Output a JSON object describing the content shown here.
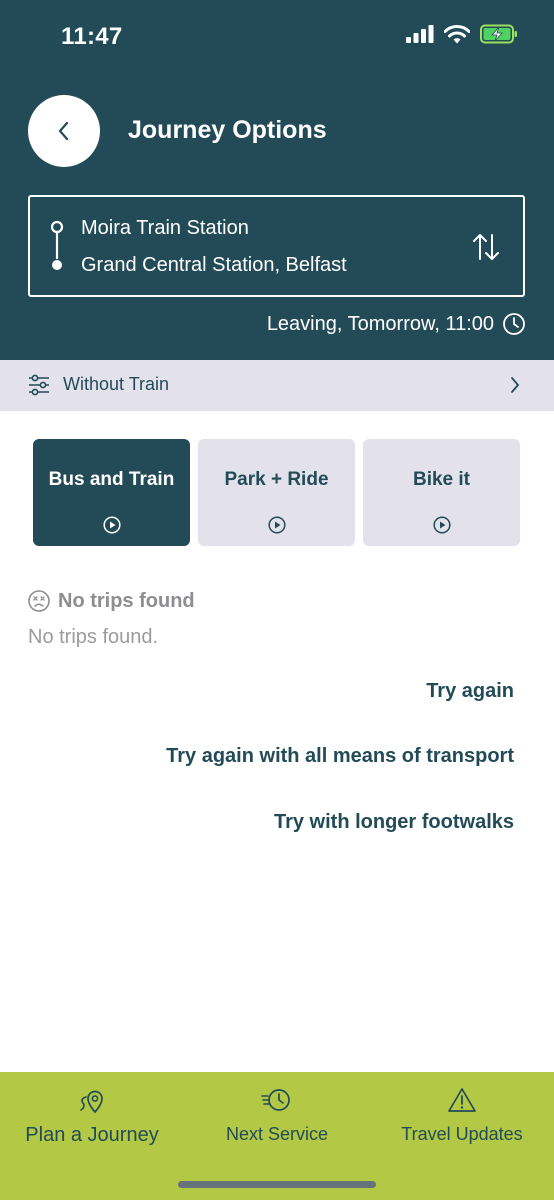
{
  "status_bar": {
    "time": "11:47",
    "icons": [
      "signal-icon",
      "wifi-icon",
      "battery-charging-icon"
    ]
  },
  "header": {
    "back_icon": "chevron-left-icon",
    "title": "Journey Options"
  },
  "route": {
    "origin": "Moira Train Station",
    "destination": "Grand Central Station, Belfast",
    "swap_icon": "swap-vertical-icon"
  },
  "leaving": {
    "text": "Leaving, Tomorrow, 11:00",
    "icon": "clock-icon"
  },
  "filter": {
    "label": "Without Train",
    "icon": "sliders-icon"
  },
  "modes": [
    {
      "label": "Bus and Train",
      "active": true
    },
    {
      "label": "Park + Ride",
      "active": false
    },
    {
      "label": "Bike it",
      "active": false
    }
  ],
  "results": {
    "heading": "No trips found",
    "message": "No trips found.",
    "actions": [
      "Try again",
      "Try again with all means of transport",
      "Try with longer footwalks"
    ]
  },
  "tabbar": {
    "tabs": [
      {
        "label": "Plan a Journey",
        "icon": "map-pin-route-icon"
      },
      {
        "label": "Next Service",
        "icon": "clock-fast-icon"
      },
      {
        "label": "Travel Updates",
        "icon": "warning-triangle-icon"
      }
    ]
  },
  "colors": {
    "primary": "#234b57",
    "tabbar": "#b3c844",
    "filter_bg": "#e3e2ec",
    "muted_text": "#8d8d92"
  }
}
